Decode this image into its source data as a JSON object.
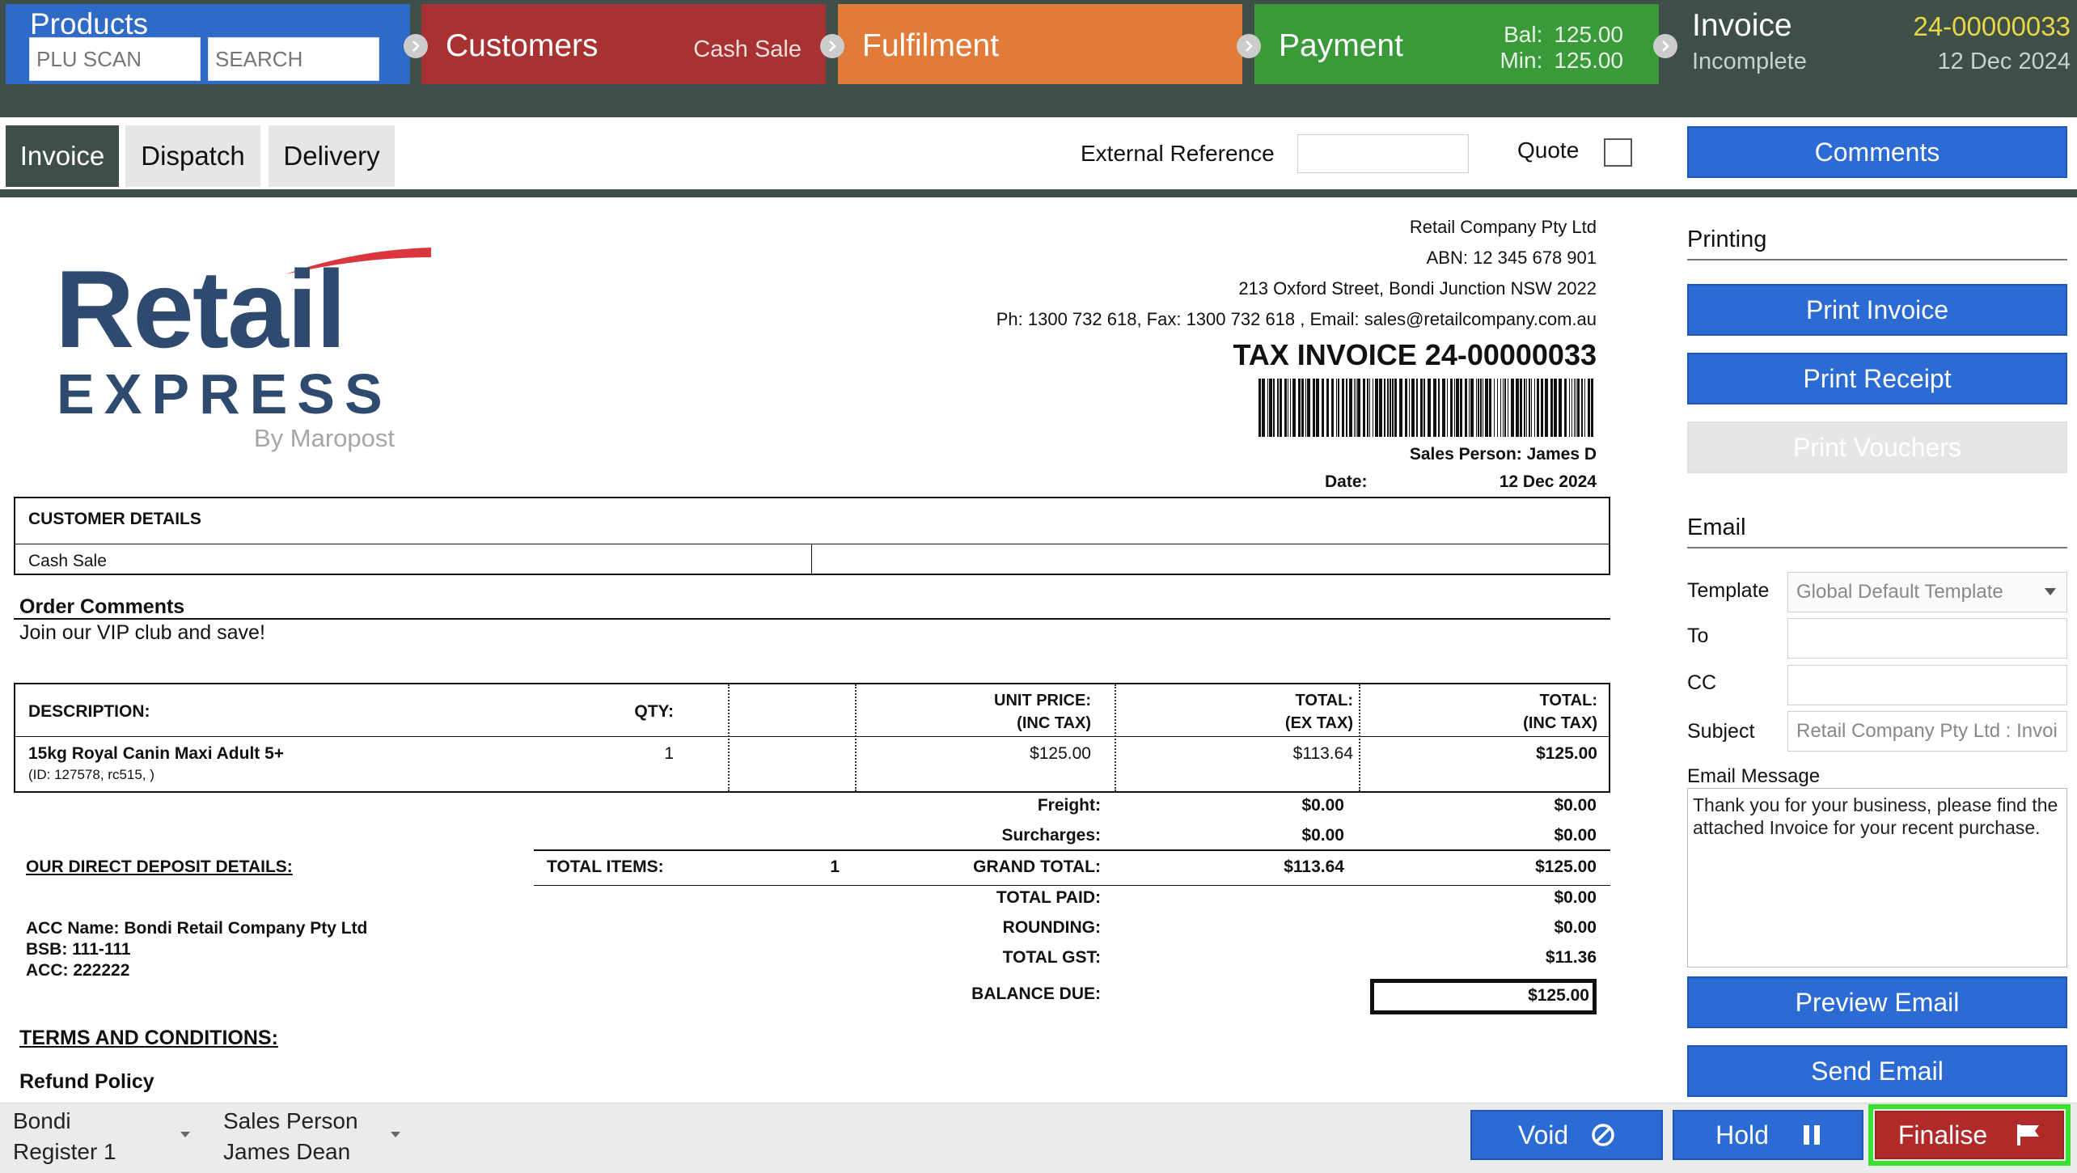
{
  "steps": {
    "products": {
      "title": "Products",
      "plu_placeholder": "PLU SCAN",
      "search_placeholder": "SEARCH",
      "color": "#2f6bc6"
    },
    "customers": {
      "title": "Customers",
      "sub": "Cash Sale",
      "color": "#a83232"
    },
    "fulfilment": {
      "title": "Fulfilment",
      "color": "#e07b39"
    },
    "payment": {
      "title": "Payment",
      "bal_label": "Bal:",
      "bal": "125.00",
      "min_label": "Min:",
      "min": "125.00",
      "color": "#3a9a3a"
    },
    "invoice": {
      "title": "Invoice",
      "number": "24-00000033",
      "status": "Incomplete",
      "date": "12 Dec 2024",
      "color": "#3d4f47"
    }
  },
  "tabs": [
    "Invoice",
    "Dispatch",
    "Delivery"
  ],
  "external_reference_label": "External Reference",
  "quote_label": "Quote",
  "comments_label": "Comments",
  "doc": {
    "logo": {
      "word1": "Retail",
      "word2": "EXPRESS",
      "by": "By Maropost"
    },
    "company": "Retail Company Pty Ltd",
    "abn": "ABN: 12 345 678 901",
    "address": "213 Oxford Street, Bondi Junction NSW 2022",
    "contact": "Ph: 1300 732 618, Fax: 1300 732 618 , Email: sales@retailcompany.com.au",
    "tax_invoice": "TAX INVOICE 24-00000033",
    "sales_person": "Sales Person: James D",
    "date_label": "Date:",
    "date": "12 Dec 2024",
    "customer_details_label": "CUSTOMER DETAILS",
    "customer": "Cash Sale",
    "order_comments_label": "Order Comments",
    "order_comments": "Join our VIP club and save!",
    "headers": {
      "description": "DESCRIPTION:",
      "qty": "QTY:",
      "unit_price_1": "UNIT PRICE:",
      "unit_price_2": "(INC TAX)",
      "total_ex_1": "TOTAL:",
      "total_ex_2": "(EX TAX)",
      "total_inc_1": "TOTAL:",
      "total_inc_2": "(INC TAX)"
    },
    "item": {
      "name": "15kg Royal Canin Maxi Adult 5+",
      "id": "(ID: 127578, rc515, )",
      "qty": "1",
      "unit_price": "$125.00",
      "total_ex": "$113.64",
      "total_inc": "$125.00"
    },
    "freight_label": "Freight:",
    "freight_ex": "$0.00",
    "freight_inc": "$0.00",
    "surcharges_label": "Surcharges:",
    "surcharges_ex": "$0.00",
    "surcharges_inc": "$0.00",
    "deposit_label": "OUR DIRECT DEPOSIT DETAILS:",
    "total_items_label": "TOTAL ITEMS:",
    "total_items": "1",
    "grand_total_label": "GRAND TOTAL:",
    "grand_total_ex": "$113.64",
    "grand_total_inc": "$125.00",
    "total_paid_label": "TOTAL PAID:",
    "total_paid": "$0.00",
    "rounding_label": "ROUNDING:",
    "rounding": "$0.00",
    "total_gst_label": "TOTAL GST:",
    "total_gst": "$11.36",
    "balance_due_label": "BALANCE DUE:",
    "balance_due": "$125.00",
    "acc_name": "ACC Name: Bondi Retail Company Pty Ltd",
    "bsb": "BSB: 111-111",
    "acc": "ACC: 222222",
    "terms_label": "TERMS AND CONDITIONS:",
    "refund_label": "Refund Policy"
  },
  "side": {
    "printing_label": "Printing",
    "print_invoice": "Print Invoice",
    "print_receipt": "Print Receipt",
    "print_vouchers": "Print Vouchers",
    "email_label": "Email",
    "template_label": "Template",
    "template_value": "Global Default Template",
    "to_label": "To",
    "cc_label": "CC",
    "subject_label": "Subject",
    "subject_value": "Retail Company Pty Ltd : Invoi",
    "email_message_label": "Email Message",
    "email_message": "Thank you for your business, please find the attached Invoice for your recent purchase.",
    "preview_email": "Preview Email",
    "send_email": "Send Email"
  },
  "footer": {
    "location": "Bondi",
    "register": "Register 1",
    "sales_person_label": "Sales Person",
    "sales_person": "James Dean",
    "void": "Void",
    "hold": "Hold",
    "finalise": "Finalise"
  }
}
